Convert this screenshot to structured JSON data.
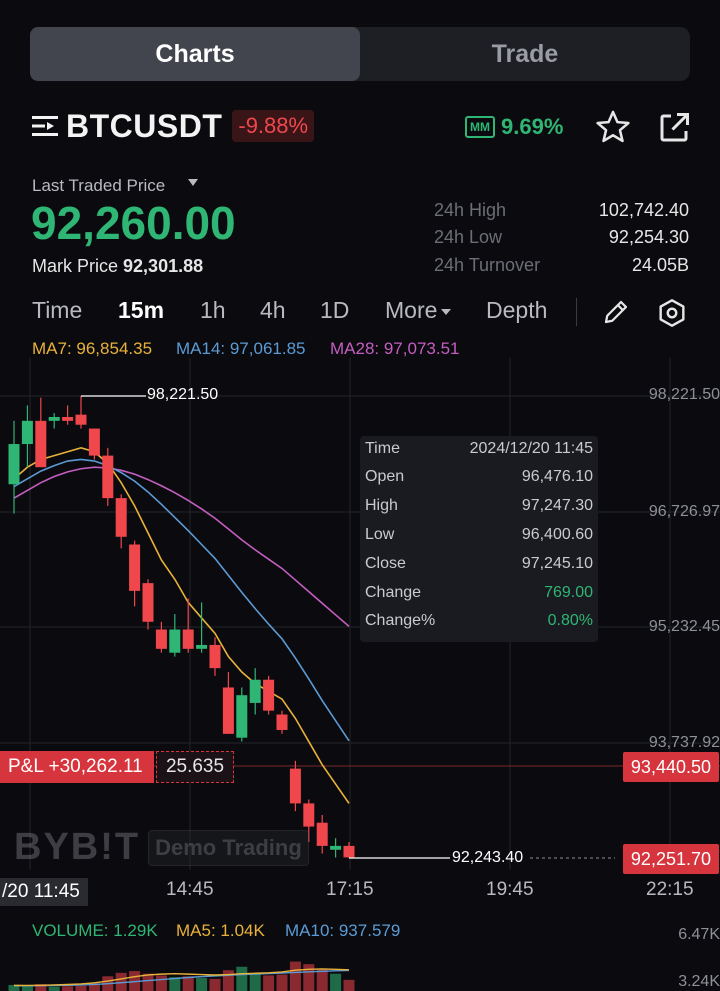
{
  "tabs": {
    "charts": "Charts",
    "trade": "Trade"
  },
  "symbol": {
    "name": "BTCUSDT",
    "change": "-9.88%",
    "mm_badge": "MM",
    "mm_value": "9.69%"
  },
  "price": {
    "last_label": "Last Traded Price",
    "last": "92,260.00",
    "mark_label": "Mark Price",
    "mark": "92,301.88"
  },
  "stats": [
    {
      "label": "24h High",
      "value": "102,742.40"
    },
    {
      "label": "24h Low",
      "value": "92,254.30"
    },
    {
      "label": "24h Turnover",
      "value": "24.05B"
    }
  ],
  "timeframes": {
    "time": "Time",
    "m15": "15m",
    "h1": "1h",
    "h4": "4h",
    "d1": "1D",
    "more": "More",
    "depth": "Depth"
  },
  "ma_legend": {
    "ma7": "MA7: 96,854.35",
    "ma14": "MA14: 97,061.85",
    "ma28": "MA28: 97,073.51"
  },
  "tooltip": {
    "time": {
      "k": "Time",
      "v": "2024/12/20 11:45"
    },
    "open": {
      "k": "Open",
      "v": "96,476.10"
    },
    "high": {
      "k": "High",
      "v": "97,247.30"
    },
    "low": {
      "k": "Low",
      "v": "96,400.60"
    },
    "close": {
      "k": "Close",
      "v": "97,245.10"
    },
    "change": {
      "k": "Change",
      "v": "769.00"
    },
    "changepct": {
      "k": "Change%",
      "v": "0.80%"
    }
  },
  "position": {
    "pnl": "P&L +30,262.11",
    "qty": "25.635"
  },
  "price_tags": {
    "entry": "93,440.50",
    "current": "92,251.70"
  },
  "marks": {
    "high": "98,221.50",
    "low": "92,243.40"
  },
  "y_axis": [
    "98,221.50",
    "96,726.97",
    "95,232.45",
    "93,737.92"
  ],
  "x_axis": {
    "cursor": "/20 11:45",
    "t1": "14:45",
    "t2": "17:15",
    "t3": "19:45",
    "t4": "22:15"
  },
  "watermark": {
    "brand": "BYB!T",
    "demo": "Demo Trading"
  },
  "volume": {
    "vol": "VOLUME: 1.29K",
    "ma5": "MA5: 1.04K",
    "ma10": "MA10: 937.579",
    "ytop": "6.47K",
    "ymid": "3.24K"
  },
  "colors": {
    "up": "#2fb574",
    "down": "#f0474d",
    "ma7": "#e8b23a",
    "ma14": "#5b9bd5",
    "ma28": "#c45ec0"
  },
  "chart_data": {
    "type": "candlestick",
    "interval": "15m",
    "ylim": [
      91900,
      98800
    ],
    "candles": [
      {
        "o": 97080,
        "h": 97900,
        "l": 96700,
        "c": 97600
      },
      {
        "o": 97600,
        "h": 98100,
        "l": 97300,
        "c": 97900
      },
      {
        "o": 97900,
        "h": 98200,
        "l": 97450,
        "c": 97300
      },
      {
        "o": 97900,
        "h": 98000,
        "l": 97800,
        "c": 97950
      },
      {
        "o": 97950,
        "h": 98100,
        "l": 97850,
        "c": 97900
      },
      {
        "o": 97980,
        "h": 98221.5,
        "l": 97800,
        "c": 97850
      },
      {
        "o": 97800,
        "h": 97800,
        "l": 97400,
        "c": 97450
      },
      {
        "o": 97450,
        "h": 97550,
        "l": 96800,
        "c": 96900
      },
      {
        "o": 96900,
        "h": 96950,
        "l": 96250,
        "c": 96400
      },
      {
        "o": 96300,
        "h": 96350,
        "l": 95500,
        "c": 95700
      },
      {
        "o": 95800,
        "h": 95850,
        "l": 95200,
        "c": 95300
      },
      {
        "o": 95200,
        "h": 95300,
        "l": 94900,
        "c": 94950
      },
      {
        "o": 94900,
        "h": 95400,
        "l": 94850,
        "c": 95200
      },
      {
        "o": 95200,
        "h": 95600,
        "l": 94900,
        "c": 94950
      },
      {
        "o": 94950,
        "h": 95550,
        "l": 94900,
        "c": 95000
      },
      {
        "o": 95000,
        "h": 95100,
        "l": 94600,
        "c": 94700
      },
      {
        "o": 94450,
        "h": 94650,
        "l": 93850,
        "c": 93850
      },
      {
        "o": 93800,
        "h": 94450,
        "l": 93750,
        "c": 94350
      },
      {
        "o": 94250,
        "h": 94700,
        "l": 94100,
        "c": 94550
      },
      {
        "o": 94550,
        "h": 94600,
        "l": 94100,
        "c": 94150
      },
      {
        "o": 94100,
        "h": 94150,
        "l": 93850,
        "c": 93900
      },
      {
        "o": 93400,
        "h": 93500,
        "l": 92850,
        "c": 92950
      },
      {
        "o": 92950,
        "h": 93000,
        "l": 92450,
        "c": 92650
      },
      {
        "o": 92700,
        "h": 92800,
        "l": 92300,
        "c": 92400
      },
      {
        "o": 92350,
        "h": 92500,
        "l": 92250,
        "c": 92400
      },
      {
        "o": 92400,
        "h": 92450,
        "l": 92243.4,
        "c": 92251.7
      }
    ],
    "ma7": [
      97150,
      97300,
      97400,
      97450,
      97500,
      97550,
      97500,
      97350,
      97100,
      96800,
      96450,
      96100,
      95850,
      95550,
      95350,
      95150,
      94850,
      94650,
      94500,
      94400,
      94300,
      94050,
      93750,
      93450,
      93200,
      92950
    ],
    "ma14": [
      97050,
      97150,
      97250,
      97320,
      97380,
      97400,
      97380,
      97320,
      97230,
      97120,
      96980,
      96820,
      96650,
      96480,
      96300,
      96120,
      95900,
      95680,
      95470,
      95270,
      95080,
      94830,
      94560,
      94280,
      94020,
      93760
    ],
    "ma28": [
      96900,
      97000,
      97100,
      97180,
      97240,
      97280,
      97300,
      97290,
      97260,
      97210,
      97140,
      97060,
      96970,
      96870,
      96760,
      96640,
      96500,
      96360,
      96230,
      96110,
      95990,
      95840,
      95690,
      95540,
      95390,
      95240
    ],
    "volume": {
      "bars": [
        700,
        600,
        800,
        500,
        550,
        600,
        900,
        1700,
        2100,
        2300,
        2000,
        1800,
        1600,
        1700,
        1500,
        1400,
        2400,
        2800,
        2000,
        1800,
        1900,
        3400,
        3100,
        2600,
        2000,
        1290
      ],
      "ma5": [
        650,
        640,
        660,
        700,
        750,
        820,
        950,
        1150,
        1400,
        1650,
        1850,
        1950,
        2000,
        1950,
        1900,
        1850,
        1900,
        2000,
        2050,
        2100,
        2200,
        2400,
        2500,
        2550,
        2500,
        2450
      ],
      "ma10": [
        600,
        610,
        620,
        640,
        660,
        700,
        760,
        850,
        960,
        1080,
        1200,
        1320,
        1440,
        1560,
        1660,
        1740,
        1820,
        1900,
        1960,
        2020,
        2080,
        2150,
        2220,
        2280,
        2330,
        2380
      ],
      "ylim": [
        0,
        6470
      ]
    }
  }
}
